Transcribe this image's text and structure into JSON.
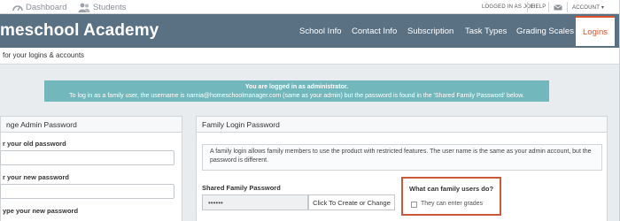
{
  "topbar": {
    "dashboard": "Dashboard",
    "students": "Students",
    "logged_in": "LOGGED IN AS JOE",
    "help": "HELP",
    "account": "ACCOUNT ▾"
  },
  "header": {
    "brand": "meschool Academy",
    "tabs": [
      "School Info",
      "Contact Info",
      "Subscription",
      "Task Types",
      "Grading Scales",
      "Logins"
    ],
    "active_tab": "Logins"
  },
  "subbar": {
    "text": "for your logins & accounts"
  },
  "alert": {
    "title": "You are logged in as administrator.",
    "body": "To log in as a family user, the username is narnia@homeschoolmanager.com (same as your admin) but the password is found in the 'Shared Family Password' below."
  },
  "admin_panel": {
    "title": "nge Admin Password",
    "old_label": "r your old password",
    "new_label": "r your new password",
    "retype_label": "ype your new password"
  },
  "family_panel": {
    "title": "Family Login Password",
    "info": "A family login allows family members to use the product with restricted features. The user name is the same as your admin account, but the password is different.",
    "pw_label": "Shared Family Password",
    "pw_value": "••••••",
    "pw_button": "Click To Create or Change",
    "question": "What can family users do?",
    "option": "They can enter grades"
  },
  "colors": {
    "header": "#5a7184",
    "accent": "#d9532c",
    "alert": "#72b7bb",
    "highlight": "#c95b38"
  }
}
